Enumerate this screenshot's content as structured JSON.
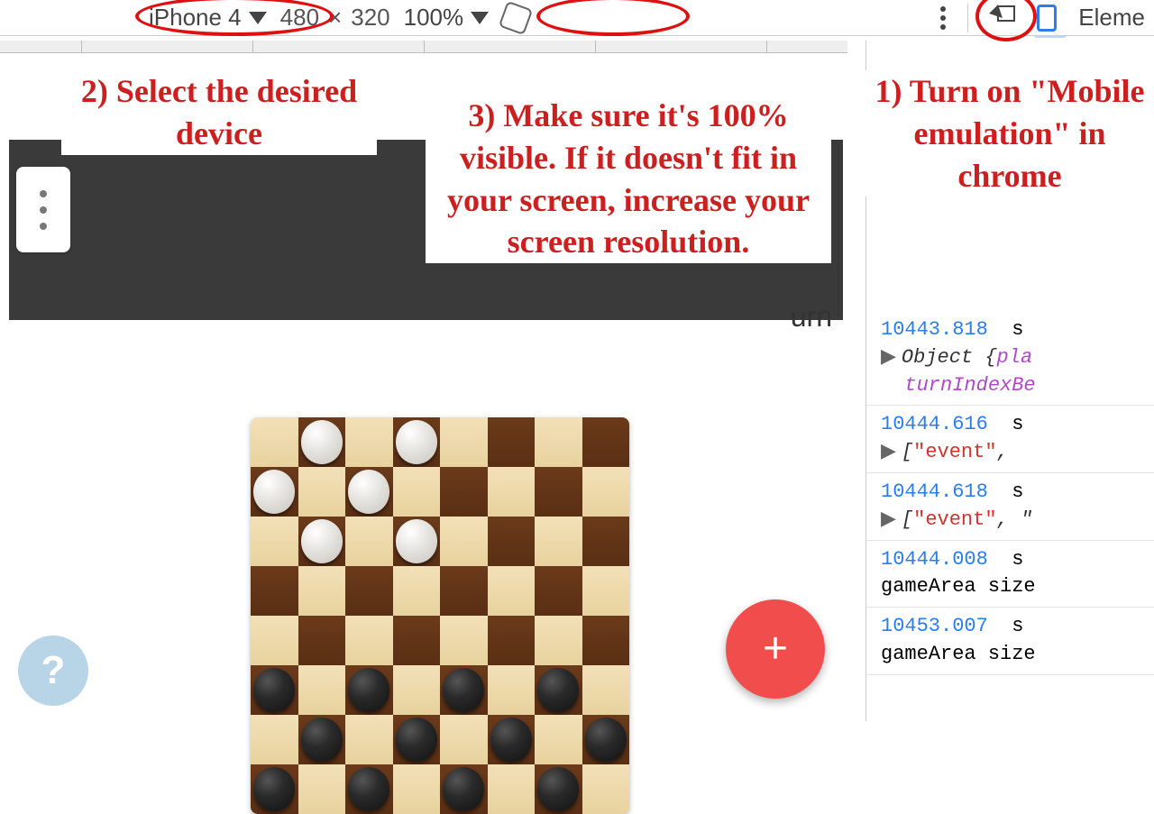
{
  "toolbar": {
    "device": "iPhone 4",
    "width": "480",
    "times": "×",
    "height": "320",
    "zoom": "100%",
    "elements_tab": "Eleme"
  },
  "annotations": {
    "a1": "1) Turn on \"Mobile emulation\" in chrome",
    "a2": "2) Select the desired device",
    "a3": "3) Make sure it's 100% visible. If it doesn't fit in your screen, increase your screen resolution."
  },
  "game": {
    "urn_fragment": "urn",
    "fab_label": "+",
    "help_label": "?"
  },
  "console": {
    "logs": [
      {
        "time": "10443.818",
        "type": "object",
        "text1": "Object {",
        "prop1": "pla",
        "prop2": "turnIndexBe"
      },
      {
        "time": "10444.616",
        "type": "array",
        "text1": "[",
        "str1": "\"event\"",
        "text2": ", "
      },
      {
        "time": "10444.618",
        "type": "array",
        "text1": "[",
        "str1": "\"event\"",
        "text2": ", \""
      },
      {
        "time": "10444.008",
        "type": "plain",
        "text1": "gameArea size"
      },
      {
        "time": "10453.007",
        "type": "plain",
        "text1": "gameArea size"
      }
    ],
    "suffix": "s"
  }
}
